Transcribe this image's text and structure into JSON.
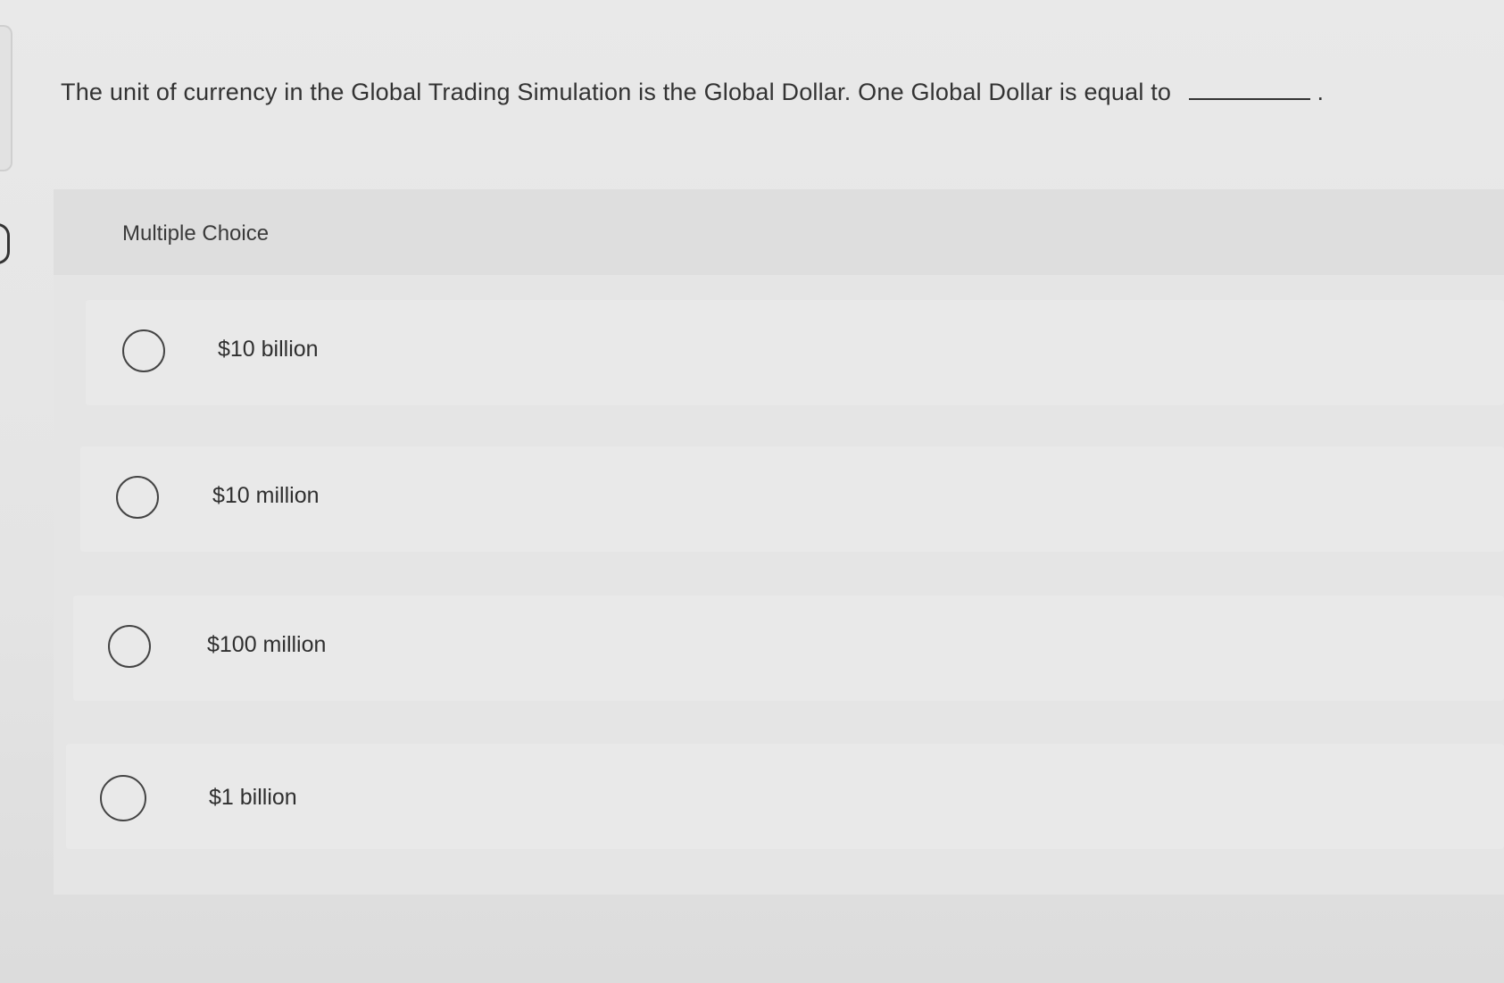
{
  "question": {
    "text": "The unit of currency in the Global Trading Simulation is the Global Dollar. One Global Dollar is equal to",
    "blank_end": "."
  },
  "section_label": "Multiple Choice",
  "options": [
    {
      "label": "$10 billion"
    },
    {
      "label": "$10 million"
    },
    {
      "label": "$100 million"
    },
    {
      "label": "$1 billion"
    }
  ],
  "colors": {
    "background": "#e6e6e6",
    "card": "#e5e5e5",
    "header": "#dedede",
    "text": "#2f2f2f"
  }
}
